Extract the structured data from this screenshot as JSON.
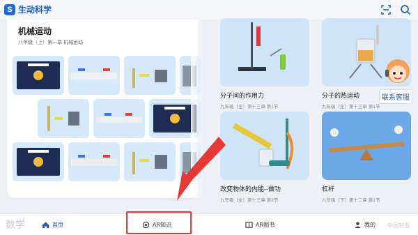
{
  "app": {
    "title": "生动科学",
    "logo_letter": "S"
  },
  "header": {
    "scan_icon": "scan-icon",
    "search_icon": "search-icon"
  },
  "left_panel": {
    "title": "机械运动",
    "subtitle": "八年级（上）第一章 机械运动"
  },
  "cards": [
    {
      "title": "分子间的作用力",
      "subtitle": "九年级（全）第十三章 第1节",
      "icon": "spring-balance-experiment"
    },
    {
      "title": "分子的热运动",
      "subtitle": "九年级（全）第十三章 第1节",
      "icon": "beaker-diffusion-experiment"
    },
    {
      "title": "改变物体的内能--做功",
      "subtitle": "九年级（全）第十三章 第2节",
      "icon": "pump-experiment"
    },
    {
      "title": "杠杆",
      "subtitle": "八年级（下）第十二章 第1节",
      "icon": "lever-seesaw"
    }
  ],
  "service": {
    "label": "联系客服",
    "icon": "customer-service-avatar"
  },
  "bottom_nav": {
    "items": [
      {
        "label": "首页",
        "icon": "home-icon",
        "active": true
      },
      {
        "label": "AR知识",
        "icon": "ar-icon",
        "active": false
      },
      {
        "label": "AR图书",
        "icon": "book-icon",
        "active": false
      },
      {
        "label": "我的",
        "icon": "user-icon",
        "active": false
      }
    ],
    "ghost_left": "数学",
    "ghost_right": "中国制造"
  },
  "colors": {
    "accent": "#1f5fc7",
    "annotation": "#e53935",
    "card_bg": "#cfe4f8"
  }
}
